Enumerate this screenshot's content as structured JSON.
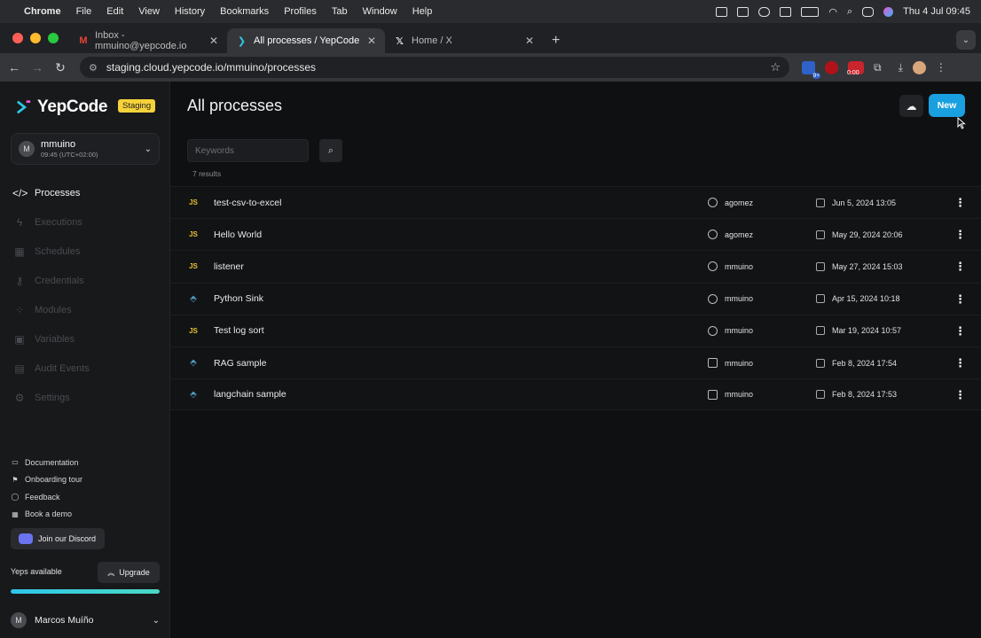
{
  "menubar": {
    "items": [
      "Chrome",
      "File",
      "Edit",
      "View",
      "History",
      "Bookmarks",
      "Profiles",
      "Tab",
      "Window",
      "Help"
    ],
    "clock": "Thu 4 Jul  09:45"
  },
  "tabs": [
    {
      "label": "Inbox - mmuino@yepcode.io",
      "icon": "gmail-icon",
      "active": false
    },
    {
      "label": "All processes / YepCode",
      "icon": "yepcode-icon",
      "active": true
    },
    {
      "label": "Home / X",
      "icon": "x-icon",
      "active": false
    }
  ],
  "address": {
    "url": "staging.cloud.yepcode.io/mmuino/processes"
  },
  "extensions": {
    "badge_count": "9+",
    "timer": "0:00"
  },
  "sidebar": {
    "brand": "YepCode",
    "env_badge": "Staging",
    "team": {
      "avatar_letter": "M",
      "name": "mmuino",
      "time": "09:45 (UTC+02:00)"
    },
    "nav": [
      {
        "label": "Processes",
        "icon": "code-icon",
        "active": true
      },
      {
        "label": "Executions",
        "icon": "bolt-icon",
        "active": false
      },
      {
        "label": "Schedules",
        "icon": "calendar-icon",
        "active": false
      },
      {
        "label": "Credentials",
        "icon": "key-icon",
        "active": false
      },
      {
        "label": "Modules",
        "icon": "modules-icon",
        "active": false
      },
      {
        "label": "Variables",
        "icon": "lock-icon",
        "active": false
      },
      {
        "label": "Audit Events",
        "icon": "audit-icon",
        "active": false
      },
      {
        "label": "Settings",
        "icon": "gear-icon",
        "active": false
      }
    ],
    "links": [
      {
        "label": "Documentation",
        "icon": "book-icon"
      },
      {
        "label": "Onboarding tour",
        "icon": "flag-icon"
      },
      {
        "label": "Feedback",
        "icon": "chat-icon"
      },
      {
        "label": "Book a demo",
        "icon": "calendar-icon"
      }
    ],
    "discord_label": "Join our Discord",
    "yeps_label": "Yeps available",
    "upgrade_label": "Upgrade",
    "yeps_fraction": 1.0,
    "user": {
      "avatar_letter": "M",
      "name": "Marcos Muíño"
    }
  },
  "main": {
    "title": "All processes",
    "new_label": "New",
    "search_placeholder": "Keywords",
    "results_text": "7 results",
    "processes": [
      {
        "lang": "JS",
        "name": "test-csv-to-excel",
        "owner": "agomez",
        "owner_icon": "history-icon",
        "date": "Jun 5, 2024 13:05"
      },
      {
        "lang": "JS",
        "name": "Hello World",
        "owner": "agomez",
        "owner_icon": "history-icon",
        "date": "May 29, 2024 20:06"
      },
      {
        "lang": "JS",
        "name": "listener",
        "owner": "mmuino",
        "owner_icon": "history-icon",
        "date": "May 27, 2024 15:03"
      },
      {
        "lang": "PY",
        "name": "Python Sink",
        "owner": "mmuino",
        "owner_icon": "history-icon",
        "date": "Apr 15, 2024 10:18"
      },
      {
        "lang": "JS",
        "name": "Test log sort",
        "owner": "mmuino",
        "owner_icon": "history-icon",
        "date": "Mar 19, 2024 10:57"
      },
      {
        "lang": "PY",
        "name": "RAG sample",
        "owner": "mmuino",
        "owner_icon": "template-icon",
        "date": "Feb 8, 2024 17:54"
      },
      {
        "lang": "PY",
        "name": "langchain sample",
        "owner": "mmuino",
        "owner_icon": "template-icon",
        "date": "Feb 8, 2024 17:53"
      }
    ]
  },
  "colors": {
    "accent": "#1aa0e0",
    "js": "#e7c12f",
    "python": "#4f9fc0",
    "staging": "#f6d23a"
  }
}
